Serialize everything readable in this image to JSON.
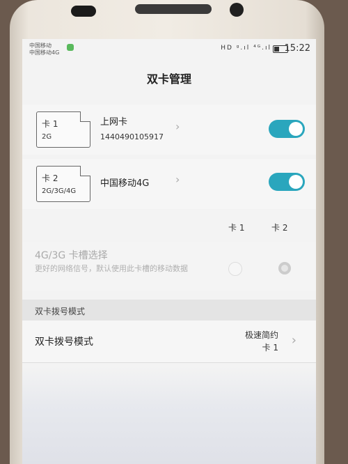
{
  "statusbar": {
    "carrier1": "中国移动",
    "carrier2": "中国移动4G",
    "icons": "HD ᵍ.ıl ⁴ᴳ.ıl",
    "time": "15:22",
    "battery_level": 0.35
  },
  "title": "双卡管理",
  "sims": [
    {
      "card": "卡 1",
      "type": "2G",
      "label": "上网卡",
      "number": "1440490105917",
      "enabled": true
    },
    {
      "card": "卡 2",
      "type": "2G/3G/4G",
      "label": "中国移动4G",
      "number": "",
      "enabled": true
    }
  ],
  "slot_header": {
    "col1": "卡 1",
    "col2": "卡 2"
  },
  "slot_select": {
    "title": "4G/3G 卡槽选择",
    "description": "更好的网络信号，默认使用此卡槽的移动数据",
    "selected": "卡 2"
  },
  "section_label": "双卡拨号模式",
  "dial_mode": {
    "title": "双卡拨号模式",
    "value_line1": "极速简约",
    "value_line2": "卡 1"
  },
  "colors": {
    "toggle_on": "#2aa6bd"
  },
  "icons": {
    "chevron": "chevron-right-icon"
  }
}
